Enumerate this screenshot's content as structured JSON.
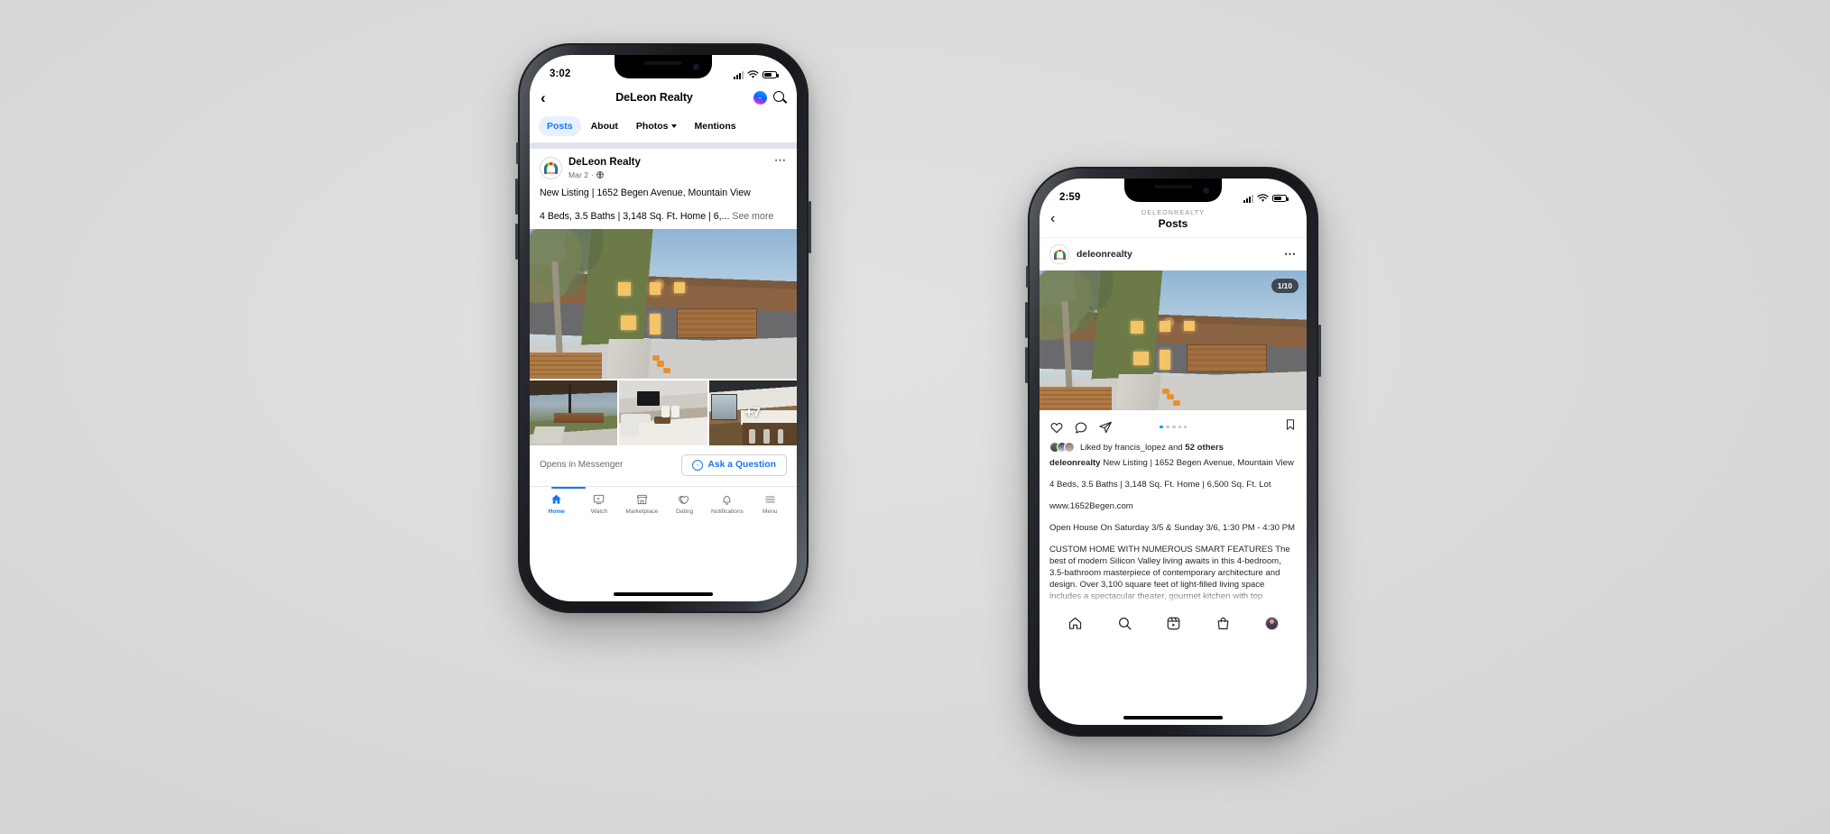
{
  "scene": {
    "background_color": "#dcdcdc"
  },
  "facebook_phone": {
    "status_bar": {
      "time": "3:02"
    },
    "header": {
      "back_icon": "chevron-left-icon",
      "title": "DeLeon Realty",
      "messenger_icon": "messenger-icon",
      "search_icon": "search-icon"
    },
    "tabs": [
      {
        "label": "Posts",
        "active": true
      },
      {
        "label": "About",
        "active": false
      },
      {
        "label": "Photos",
        "active": false,
        "has_caret": true
      },
      {
        "label": "Mentions",
        "active": false
      }
    ],
    "post": {
      "page_name": "DeLeon Realty",
      "date": "Mar 2",
      "separator": "·",
      "audience_icon": "globe-icon",
      "more_icon": "ellipsis-icon",
      "text_line_1": "New Listing | 1652 Begen Avenue, Mountain View",
      "text_line_2": "4 Beds, 3.5 Baths | 3,148 Sq. Ft. Home | 6,...",
      "see_more": "See more",
      "extra_photos_badge": "+7"
    },
    "cta": {
      "opens_label": "Opens in Messenger",
      "button_label": "Ask a Question",
      "button_icon": "messenger-icon",
      "accent_color": "#1877f2"
    },
    "bottom_nav": [
      {
        "label": "Home",
        "icon": "home-icon",
        "active": true
      },
      {
        "label": "Watch",
        "icon": "video-icon",
        "active": false
      },
      {
        "label": "Marketplace",
        "icon": "store-icon",
        "active": false
      },
      {
        "label": "Dating",
        "icon": "heart-icon",
        "active": false
      },
      {
        "label": "Notifications",
        "icon": "bell-icon",
        "active": false
      },
      {
        "label": "Menu",
        "icon": "hamburger-icon",
        "active": false
      }
    ]
  },
  "instagram_phone": {
    "status_bar": {
      "time": "2:59"
    },
    "header": {
      "back_icon": "chevron-left-icon",
      "kicker": "DELEONREALTY",
      "title": "Posts"
    },
    "post": {
      "username": "deleonrealty",
      "more_icon": "ellipsis-icon",
      "carousel_counter": "1/10",
      "carousel_total_dots": 5,
      "carousel_active_index": 0,
      "actions": {
        "like_icon": "heart-icon",
        "comment_icon": "comment-icon",
        "share_icon": "paper-plane-icon",
        "save_icon": "bookmark-icon"
      },
      "liked_by_prefix": "Liked by",
      "liked_by_user": "francis_lopez",
      "liked_by_middle": "and",
      "liked_by_others": "52 others",
      "caption_username": "deleonrealty",
      "caption_paragraphs": [
        "New Listing | 1652 Begen Avenue, Mountain View",
        "4 Beds, 3.5 Baths | 3,148 Sq. Ft. Home | 6,500 Sq. Ft. Lot",
        "www.1652Begen.com",
        "Open House On Saturday 3/5 & Sunday 3/6, 1:30 PM - 4:30 PM",
        "CUSTOM HOME WITH NUMEROUS SMART FEATURES The best of modern Silicon Valley living awaits in this 4-bedroom, 3.5-bathroom masterpiece of contemporary architecture and design. Over 3,100 square feet of light-filled living space includes a spectacular theater, gourmet kitchen with top appliances, and a wall of glass"
      ]
    },
    "bottom_nav": [
      {
        "icon": "home-icon"
      },
      {
        "icon": "search-icon"
      },
      {
        "icon": "reels-icon"
      },
      {
        "icon": "shop-icon"
      },
      {
        "icon": "profile-avatar"
      }
    ]
  }
}
